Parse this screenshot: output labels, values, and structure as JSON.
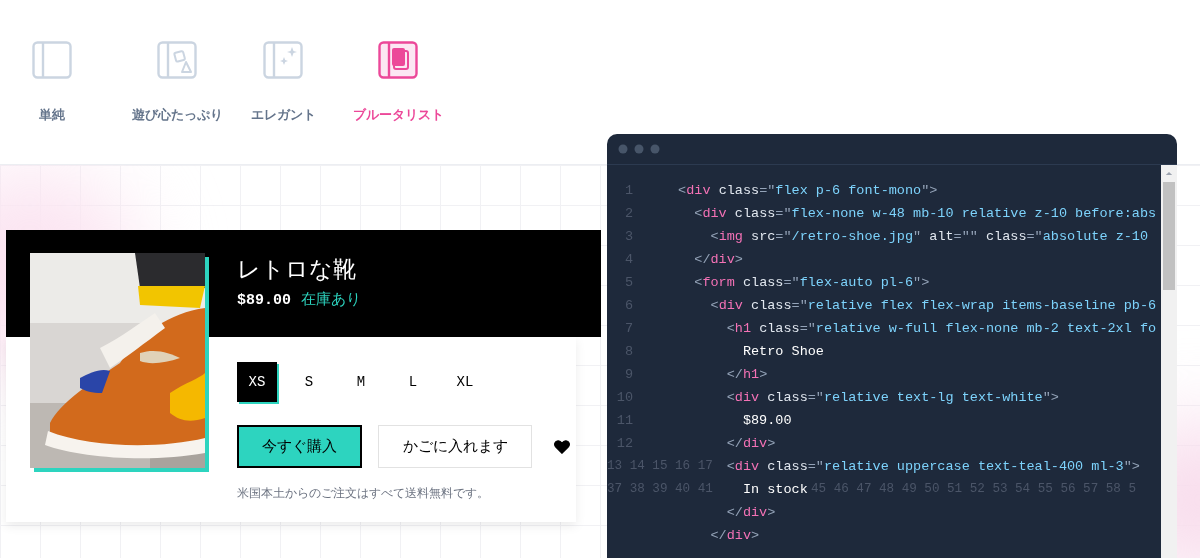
{
  "styles": [
    {
      "label": "単純",
      "selected": false
    },
    {
      "label": "遊び心たっぷり",
      "selected": false
    },
    {
      "label": "エレガント",
      "selected": false
    },
    {
      "label": "ブルータリスト",
      "selected": true
    }
  ],
  "product": {
    "title": "レトロな靴",
    "price": "$89.00",
    "stock": "在庫あり",
    "sizes": [
      {
        "label": "XS",
        "selected": true
      },
      {
        "label": "S",
        "selected": false
      },
      {
        "label": "M",
        "selected": false
      },
      {
        "label": "L",
        "selected": false
      },
      {
        "label": "XL",
        "selected": false
      }
    ],
    "buy_button": "今すぐ購入",
    "cart_button": "かごに入れます",
    "favorite": true,
    "note": "米国本土からのご注文はすべて送料無料です。"
  },
  "code": [
    {
      "number": "1",
      "tokens": [
        {
          "kind": "p",
          "text": "<"
        },
        {
          "kind": "t",
          "text": "div"
        },
        {
          "kind": "a",
          "text": " class"
        },
        {
          "kind": "p",
          "text": "=\""
        },
        {
          "kind": "s",
          "text": "flex p-6 font-mono"
        },
        {
          "kind": "p",
          "text": "\">"
        }
      ]
    },
    {
      "number": "2",
      "tokens": [
        {
          "kind": "p",
          "text": "  <"
        },
        {
          "kind": "t",
          "text": "div"
        },
        {
          "kind": "a",
          "text": " class"
        },
        {
          "kind": "p",
          "text": "=\""
        },
        {
          "kind": "s",
          "text": "flex-none w-48 mb-10 relative z-10 before:abs"
        }
      ]
    },
    {
      "number": "3",
      "tokens": [
        {
          "kind": "p",
          "text": "    <"
        },
        {
          "kind": "t",
          "text": "img"
        },
        {
          "kind": "a",
          "text": " src"
        },
        {
          "kind": "p",
          "text": "=\""
        },
        {
          "kind": "s",
          "text": "/retro-shoe.jpg"
        },
        {
          "kind": "p",
          "text": "\""
        },
        {
          "kind": "a",
          "text": " alt"
        },
        {
          "kind": "p",
          "text": "=\"\""
        },
        {
          "kind": "a",
          "text": " class"
        },
        {
          "kind": "p",
          "text": "=\""
        },
        {
          "kind": "s",
          "text": "absolute z-10"
        }
      ]
    },
    {
      "number": "4",
      "tokens": [
        {
          "kind": "p",
          "text": "  </"
        },
        {
          "kind": "t",
          "text": "div"
        },
        {
          "kind": "p",
          "text": ">"
        }
      ]
    },
    {
      "number": "5",
      "tokens": [
        {
          "kind": "p",
          "text": "  <"
        },
        {
          "kind": "t",
          "text": "form"
        },
        {
          "kind": "a",
          "text": " class"
        },
        {
          "kind": "p",
          "text": "=\""
        },
        {
          "kind": "s",
          "text": "flex-auto pl-6"
        },
        {
          "kind": "p",
          "text": "\">"
        }
      ]
    },
    {
      "number": "6",
      "tokens": [
        {
          "kind": "p",
          "text": "    <"
        },
        {
          "kind": "t",
          "text": "div"
        },
        {
          "kind": "a",
          "text": " class"
        },
        {
          "kind": "p",
          "text": "=\""
        },
        {
          "kind": "s",
          "text": "relative flex flex-wrap items-baseline pb-6"
        }
      ]
    },
    {
      "number": "7",
      "tokens": [
        {
          "kind": "p",
          "text": "      <"
        },
        {
          "kind": "t",
          "text": "h1"
        },
        {
          "kind": "a",
          "text": " class"
        },
        {
          "kind": "p",
          "text": "=\""
        },
        {
          "kind": "s",
          "text": "relative w-full flex-none mb-2 text-2xl fo"
        }
      ]
    },
    {
      "number": "8",
      "tokens": [
        {
          "kind": "x",
          "text": "        Retro Shoe"
        }
      ]
    },
    {
      "number": "9",
      "tokens": [
        {
          "kind": "p",
          "text": "      </"
        },
        {
          "kind": "t",
          "text": "h1"
        },
        {
          "kind": "p",
          "text": ">"
        }
      ]
    },
    {
      "number": "10",
      "tokens": [
        {
          "kind": "p",
          "text": "      <"
        },
        {
          "kind": "t",
          "text": "div"
        },
        {
          "kind": "a",
          "text": " class"
        },
        {
          "kind": "p",
          "text": "=\""
        },
        {
          "kind": "s",
          "text": "relative text-lg text-white"
        },
        {
          "kind": "p",
          "text": "\">"
        }
      ]
    },
    {
      "number": "11",
      "tokens": [
        {
          "kind": "x",
          "text": "        $89.00"
        }
      ]
    },
    {
      "number": "12",
      "tokens": [
        {
          "kind": "p",
          "text": "      </"
        },
        {
          "kind": "t",
          "text": "div"
        },
        {
          "kind": "p",
          "text": ">"
        }
      ]
    },
    {
      "number": "13 14 15 16 17",
      "tokens": [
        {
          "kind": "p",
          "text": "      <"
        },
        {
          "kind": "t",
          "text": "div"
        },
        {
          "kind": "a",
          "text": " class"
        },
        {
          "kind": "p",
          "text": "=\""
        },
        {
          "kind": "s",
          "text": "relative uppercase text-teal-400 ml-3"
        },
        {
          "kind": "p",
          "text": "\">"
        }
      ]
    },
    {
      "number": "37 38 39 40 41",
      "tokens": [
        {
          "kind": "x",
          "text": "        In stock"
        }
      ],
      "trailing": "45 46 47 48 49 50 51 52 53 54 55 56 57 58 5"
    },
    {
      "tokens": [
        {
          "kind": "p",
          "text": "      </"
        },
        {
          "kind": "t",
          "text": "div"
        },
        {
          "kind": "p",
          "text": ">"
        }
      ]
    },
    {
      "tokens": [
        {
          "kind": "p",
          "text": "    </"
        },
        {
          "kind": "t",
          "text": "div"
        },
        {
          "kind": "p",
          "text": ">"
        }
      ]
    }
  ]
}
